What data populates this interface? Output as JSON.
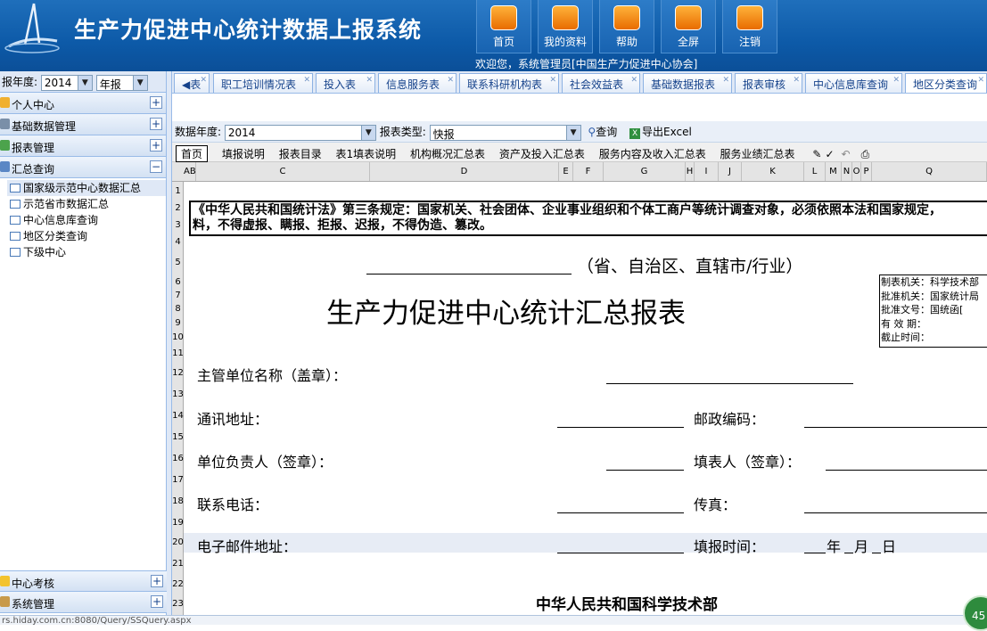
{
  "app": {
    "title": "生产力促进中心统计数据上报系统",
    "welcome": "欢迎您，系统管理员[中国生产力促进中心协会]"
  },
  "topnav": [
    {
      "label": "首页",
      "icon": "home-icon"
    },
    {
      "label": "我的资料",
      "icon": "profile-icon"
    },
    {
      "label": "帮助",
      "icon": "help-bulb-icon"
    },
    {
      "label": "全屏",
      "icon": "fullscreen-icon"
    },
    {
      "label": "注销",
      "icon": "logout-icon"
    }
  ],
  "left": {
    "year_label": "报年度:",
    "year_value": "2014",
    "period_value": "年报",
    "sections_top": [
      {
        "label": "个人中心",
        "sign": "+"
      },
      {
        "label": "基础数据管理",
        "sign": "+"
      },
      {
        "label": "报表管理",
        "sign": "+"
      },
      {
        "label": "汇总查询",
        "sign": "−"
      }
    ],
    "tree": [
      "国家级示范中心数据汇总",
      "示范省市数据汇总",
      "中心信息库查询",
      "地区分类查询",
      "下级中心"
    ],
    "sections_bottom": [
      {
        "label": "中心考核",
        "sign": "+"
      },
      {
        "label": "系统管理",
        "sign": "+"
      }
    ]
  },
  "tabs": [
    "表",
    "职工培训情况表",
    "投入表",
    "信息服务表",
    "联系科研机构表",
    "社会效益表",
    "基础数据报表",
    "报表审核",
    "中心信息库查询",
    "地区分类查询"
  ],
  "filter": {
    "year_label": "数据年度:",
    "year_value": "2014",
    "type_label": "报表类型:",
    "type_value": "快报",
    "query_label": "查询",
    "export_label": "导出Excel"
  },
  "sheet_tabs": [
    "首页",
    "填报说明",
    "报表目录",
    "表1填表说明",
    "机构概况汇总表",
    "资产及投入汇总表",
    "服务内容及收入汇总表",
    "服务业绩汇总表"
  ],
  "columns": [
    "AB",
    "C",
    "D",
    "E",
    "F",
    "G",
    "H",
    "I",
    "J",
    "K",
    "L",
    "M",
    "N",
    "O",
    "P",
    "Q"
  ],
  "rows": [
    "1",
    "2",
    "3",
    "4",
    "5",
    "6",
    "7",
    "8",
    "9",
    "10",
    "11",
    "12",
    "13",
    "14",
    "15",
    "16",
    "17",
    "18",
    "19",
    "20",
    "21",
    "22",
    "23"
  ],
  "form": {
    "notice_line1": "《中华人民共和国统计法》第三条规定：国家机关、社会团体、企业事业组织和个体工商户等统计调查对象，必须依照本法和国家规定，",
    "notice_line2": "料，不得虚报、瞒报、拒报、迟报，不得伪造、篡改。",
    "region": "（省、自治区、直辖市/行业）",
    "title": "生产力促进中心统计汇总报表",
    "info": [
      "制表机关：科学技术部",
      "批准机关：国家统计局",
      "批准文号：国统函[",
      "有 效 期：",
      "截止时间："
    ],
    "field_unit": "主管单位名称（盖章）：",
    "field_address": "通讯地址：",
    "field_postcode": "邮政编码：",
    "field_leader": "单位负责人（签章）：",
    "field_filler": "填表人（签章）：",
    "field_phone": "联系电话：",
    "field_fax": "传真：",
    "field_email": "电子邮件地址：",
    "field_date": "填报时间：",
    "date_year": "年",
    "date_month": "月",
    "date_day": "日",
    "footer": "中华人民共和国科学技术部"
  },
  "status": {
    "url": "rs.hiday.com.cn:8080/Query/SSQuery.aspx",
    "badge": "45"
  }
}
